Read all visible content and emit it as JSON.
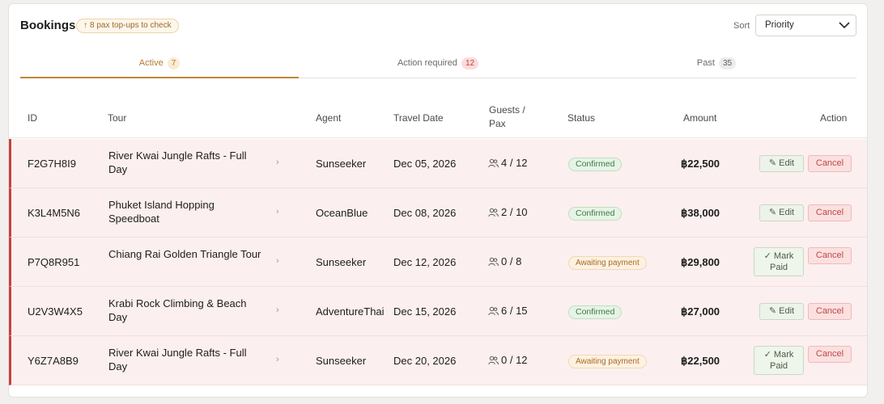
{
  "header": {
    "title": "Bookings",
    "notice": "8 pax top-ups to check",
    "sort_label": "Sort",
    "sort_value": "Priority"
  },
  "tabs": [
    {
      "label": "Active",
      "count": "7",
      "active": true
    },
    {
      "label": "Action required",
      "count": "12",
      "active": false
    },
    {
      "label": "Past",
      "count": "35",
      "active": false
    }
  ],
  "columns": {
    "id": "ID",
    "tour": "Tour",
    "agent": "Agent",
    "date": "Travel Date",
    "guests_line1": "Guests /",
    "guests_line2": "Pax",
    "status": "Status",
    "amount": "Amount",
    "action": "Action"
  },
  "actions": {
    "edit": "Edit",
    "mark_line1": "✓ Mark",
    "mark_line2": "Paid",
    "cancel": "Cancel"
  },
  "rows": [
    {
      "id": "F2G7H8I9",
      "tour": "River Kwai Jungle Rafts - Full Day",
      "agent": "Sunseeker",
      "date": "Dec 05, 2026",
      "guests": "4 / 12",
      "status": "Confirmed",
      "amount": "฿22,500"
    },
    {
      "id": "K3L4M5N6",
      "tour": "Phuket Island Hopping Speedboat",
      "agent": "OceanBlue",
      "date": "Dec 08, 2026",
      "guests": "2 / 10",
      "status": "Confirmed",
      "amount": "฿38,000"
    },
    {
      "id": "P7Q8R951",
      "tour": "Chiang Rai Golden Triangle Tour",
      "agent": "Sunseeker",
      "date": "Dec 12, 2026",
      "guests": "0 / 8",
      "status": "Awaiting payment",
      "amount": "฿29,800"
    },
    {
      "id": "U2V3W4X5",
      "tour": "Krabi Rock Climbing & Beach Day",
      "agent": "AdventureThai",
      "date": "Dec 15, 2026",
      "guests": "6 / 15",
      "status": "Confirmed",
      "amount": "฿27,000"
    },
    {
      "id": "Y6Z7A8B9",
      "tour": "River Kwai Jungle Rafts - Full Day",
      "agent": "Sunseeker",
      "date": "Dec 20, 2026",
      "guests": "0 / 12",
      "status": "Awaiting payment",
      "amount": "฿22,500"
    }
  ]
}
